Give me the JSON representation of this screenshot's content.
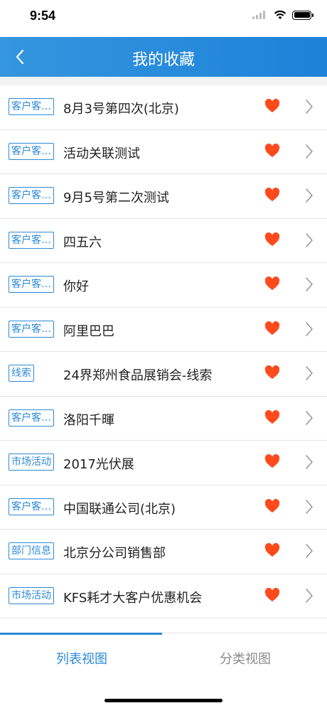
{
  "status_bar": {
    "time": "9:54"
  },
  "nav": {
    "title": "我的收藏",
    "back_icon": "chevron-left-icon"
  },
  "items": [
    {
      "tag": "客户客…",
      "title": "8月3号第四次(北京)"
    },
    {
      "tag": "客户客…",
      "title": "活动关联测试"
    },
    {
      "tag": "客户客…",
      "title": "9月5号第二次测试"
    },
    {
      "tag": "客户客…",
      "title": "四五六"
    },
    {
      "tag": "客户客…",
      "title": "你好"
    },
    {
      "tag": "客户客…",
      "title": "阿里巴巴"
    },
    {
      "tag": "线索",
      "title": "24界郑州食品展销会-线索"
    },
    {
      "tag": "客户客…",
      "title": "洛阳千暉"
    },
    {
      "tag": "市场活动",
      "title": "2017光伏展"
    },
    {
      "tag": "客户客…",
      "title": "中国联通公司(北京)"
    },
    {
      "tag": "部门信息",
      "title": "北京分公司销售部"
    },
    {
      "tag": "市场活动",
      "title": "KFS耗才大客户优惠机会"
    }
  ],
  "tabs": {
    "list_label": "列表视图",
    "category_label": "分类视图",
    "active": "列表视图"
  },
  "colors": {
    "accent": "#2c8ad8",
    "nav_bg": "#1d82d8",
    "heart": "#ff4a1c"
  },
  "icons": {
    "heart": "heart-icon",
    "chevron": "chevron-right-icon"
  }
}
